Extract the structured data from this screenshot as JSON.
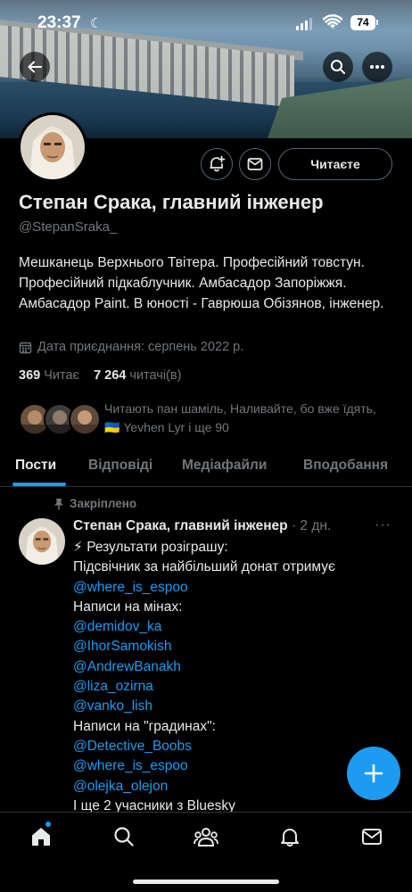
{
  "status_bar": {
    "time": "23:37",
    "battery": "74"
  },
  "profile": {
    "name": "Степан Срака, главний інженер",
    "handle": "@StepanSraka_",
    "bio": "Мешканець Верхнього Твітера. Професійний товстун. Професійний підкаблучник. Амбасадор Запоріжжя. Амбасадор Paint. В юності - Гаврюша Обізянов, інженер.",
    "joined": "Дата приєднання: серпень 2022 р.",
    "following_count": "369",
    "following_label": "Читає",
    "followers_count": "7 264",
    "followers_label": "читачі(в)",
    "known_followers_prefix": "Читають пан шаміль, Наливайте, бо вже їдять, ",
    "known_followers_flag": "🇺🇦",
    "known_followers_suffix": " Yevhen Lyr і ще 90",
    "follow_button_label": "Читаєте"
  },
  "tabs": [
    {
      "label": "Пости",
      "active": true
    },
    {
      "label": "Відповіді",
      "active": false
    },
    {
      "label": "Медіафайли",
      "active": false
    },
    {
      "label": "Вподобання",
      "active": false
    }
  ],
  "post": {
    "pinned_label": "Закріплено",
    "author": "Степан Срака, главний інженер",
    "time": " · 2 дн.",
    "more": "···",
    "lines": [
      {
        "text": "⚡ Результати розіграшу:",
        "mention": false
      },
      {
        "text": "Підсвічник за найбільший донат отримує",
        "mention": false
      },
      {
        "text": "@where_is_espoo",
        "mention": true
      },
      {
        "text": "Написи на мінах:",
        "mention": false
      },
      {
        "text": "@demidov_ka",
        "mention": true
      },
      {
        "text": "@IhorSamokish",
        "mention": true
      },
      {
        "text": "@AndrewBanakh",
        "mention": true
      },
      {
        "text": "@liza_ozirna",
        "mention": true
      },
      {
        "text": "@vanko_lish",
        "mention": true
      },
      {
        "text": "Написи на \"градинах\":",
        "mention": false
      },
      {
        "text": "@Detective_Boobs",
        "mention": true
      },
      {
        "text": "@where_is_espoo",
        "mention": true
      },
      {
        "text": "@olejka_olejon",
        "mention": true
      },
      {
        "text": "І ще 2 учасники з Bluesky",
        "mention": false
      }
    ]
  },
  "icons": {
    "back": "arrow-left-icon",
    "search": "search-icon",
    "more": "more-icon",
    "notify": "bell-plus-icon",
    "message": "envelope-icon",
    "calendar": "calendar-icon",
    "pin": "pin-icon",
    "compose": "plus-icon",
    "nav": [
      "home-icon",
      "search-icon",
      "people-icon",
      "bell-icon",
      "envelope-icon"
    ]
  },
  "colors": {
    "accent": "#1d9bf0",
    "muted": "#71767b",
    "text": "#e7e9ea",
    "background": "#000000"
  }
}
